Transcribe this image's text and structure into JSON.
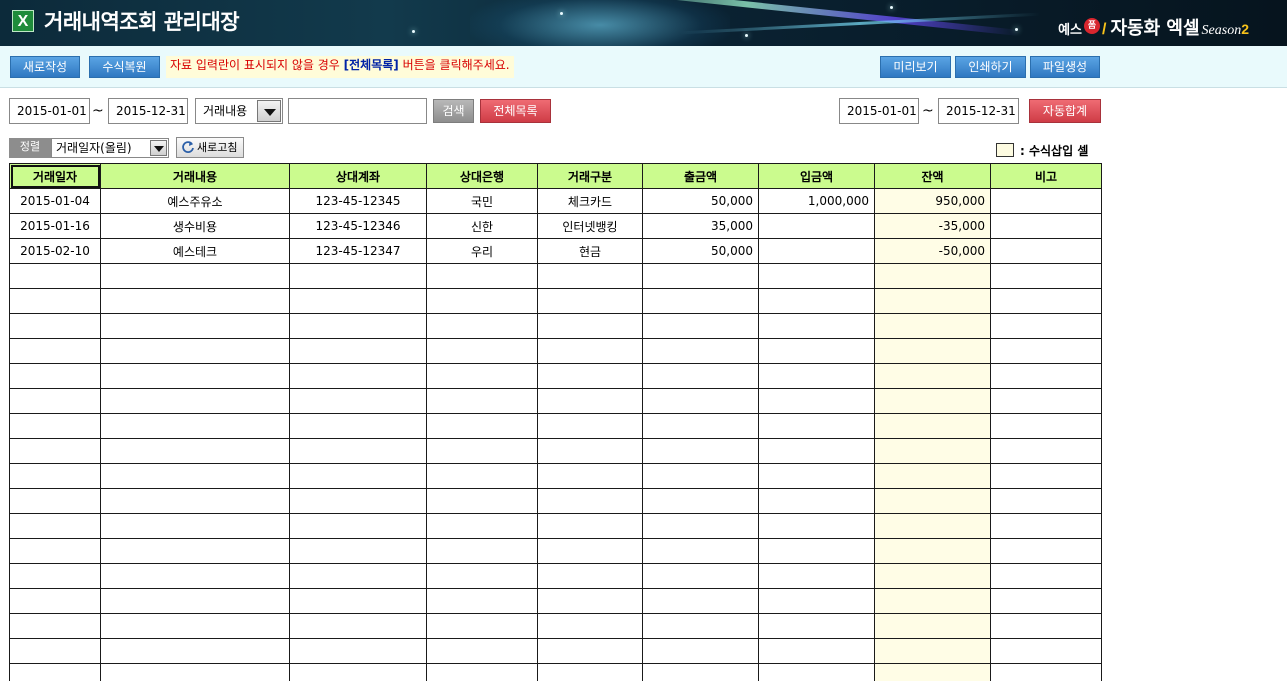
{
  "header": {
    "title": "거래내역조회 관리대장",
    "brand_prefix": "예스",
    "brand_badge": "폼",
    "brand_name": "자동화 엑셀",
    "brand_season": "Season",
    "brand_season_num": "2",
    "app_icon": "excel-icon"
  },
  "toolbar": {
    "new_label": "새로작성",
    "restore_label": "수식복원",
    "notice_before": "자료 입력란이 표시되지  않을 경우 ",
    "notice_highlight": "[전체목록]",
    "notice_after": " 버튼을 클릭해주세요.",
    "preview_label": "미리보기",
    "print_label": "인쇄하기",
    "file_label": "파일생성"
  },
  "filter": {
    "date_from": "2015-01-01",
    "date_to": "2015-12-31",
    "tilde": "~",
    "field_select": "거래내용",
    "search_value": "",
    "search_label": "검색",
    "all_list_label": "전체목록",
    "sum_date_from": "2015-01-01",
    "sum_date_to": "2015-12-31",
    "auto_sum_label": "자동합계"
  },
  "sort": {
    "label": "정렬",
    "value": "거래일자(올림)",
    "refresh_label": "새로고침",
    "legend_label": ": 수식삽입 셀"
  },
  "table": {
    "columns": [
      "거래일자",
      "거래내용",
      "상대계좌",
      "상대은행",
      "거래구분",
      "출금액",
      "입금액",
      "잔액",
      "비고"
    ],
    "rows": [
      [
        "2015-01-04",
        "예스주유소",
        "123-45-12345",
        "국민",
        "체크카드",
        "50,000",
        "1,000,000",
        "950,000",
        ""
      ],
      [
        "2015-01-16",
        "생수비용",
        "123-45-12346",
        "신한",
        "인터넷뱅킹",
        "35,000",
        "",
        "-35,000",
        ""
      ],
      [
        "2015-02-10",
        "예스테크",
        "123-45-12347",
        "우리",
        "현금",
        "50,000",
        "",
        "-50,000",
        ""
      ]
    ],
    "empty_rows": 17
  },
  "colors": {
    "header_green": "#cbfb8e",
    "formula_cell": "#fffde6",
    "blue_button": "#2f78c1",
    "red_button": "#cf3c46"
  }
}
